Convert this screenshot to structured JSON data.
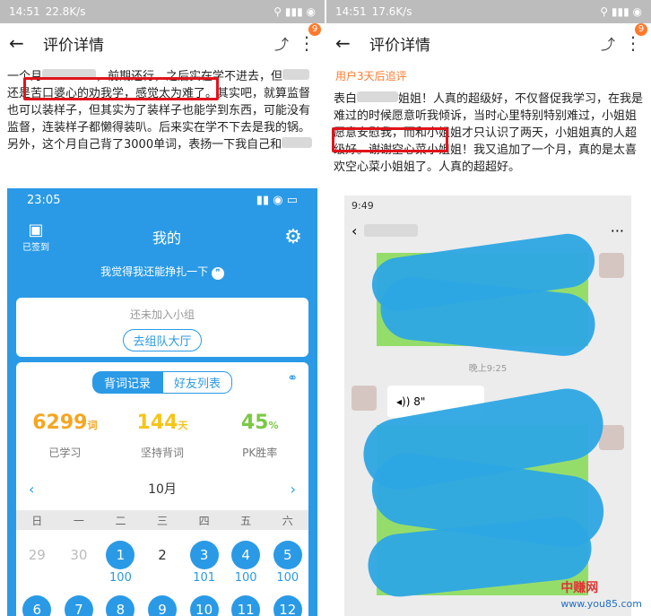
{
  "left": {
    "status": {
      "time": "14:51",
      "speed": "22.8K/s",
      "icons": "⚲ ▮▮▮ ◉"
    },
    "appbar": {
      "back": "←",
      "title": "评价详情",
      "share": "⤴",
      "more": "⋮",
      "badge": "9"
    },
    "review_text_1": "一个月",
    "review_text_2": "，前期还行，之后实在学不进去，但",
    "highlight": "还是苦口婆心的劝我学，",
    "review_text_3": "感觉太为难了。其实吧，就算监督也可以装样子，但其实为了装样子也能学到东西，可能没有监督，连装样子都懒得装叭。后来实在学不下去是我的锅。另外，这个月自己背了3000单词，表扬一下我自己和",
    "inner": {
      "time": "23:05",
      "signed": "已签到",
      "title": "我的",
      "motto": "我觉得我还能挣扎一下",
      "group_tip": "还未加入小组",
      "group_btn": "去组队大厅",
      "tab_words": "背词记录",
      "tab_friends": "好友列表",
      "stats": [
        {
          "num": "6299",
          "unit": "词",
          "label": "已学习",
          "color": "#f5a623"
        },
        {
          "num": "144",
          "unit": "天",
          "label": "坚持背词",
          "color": "#f5c51b"
        },
        {
          "num": "45",
          "unit": "%",
          "label": "PK胜率",
          "color": "#7ac943"
        }
      ],
      "month": "10月",
      "weekdays": [
        "日",
        "一",
        "二",
        "三",
        "四",
        "五",
        "六"
      ],
      "row1": [
        {
          "d": "29",
          "n": "",
          "style": "gray"
        },
        {
          "d": "30",
          "n": "",
          "style": "gray"
        },
        {
          "d": "1",
          "n": "100",
          "style": "blue"
        },
        {
          "d": "2",
          "n": "",
          "style": "plain"
        },
        {
          "d": "3",
          "n": "101",
          "style": "blue"
        },
        {
          "d": "4",
          "n": "100",
          "style": "blue"
        },
        {
          "d": "5",
          "n": "100",
          "style": "blue"
        }
      ],
      "row2": [
        "6",
        "7",
        "8",
        "9",
        "10",
        "11",
        "12"
      ]
    }
  },
  "right": {
    "status": {
      "time": "14:51",
      "speed": "17.6K/s",
      "icons": "⚲ ▮▮▮ ◉"
    },
    "appbar": {
      "back": "←",
      "title": "评价详情",
      "share": "⤴",
      "more": "⋮",
      "badge": "9"
    },
    "followup": "用户3天后追评",
    "text_1": "表白",
    "text_2": "姐姐！人真的超级好，不仅督促我学习，在我是难过的时候愿意听我倾诉，当时心里特别特别难过，",
    "highlight": "小姐姐愿意安慰我，",
    "text_3": "而和小姐姐才只认识了两天，小姐姐真的人超级好。谢谢空心菜小姐姐！我又追加了一个月，真的是太喜欢空心菜小姐姐了。人真的超超好。",
    "chat": {
      "time": "9:49",
      "timestamp": "晚上9:25",
      "voice": "◂)) 8\"",
      "back": "‹",
      "more": "···"
    }
  },
  "watermark": {
    "cn": "中赚网",
    "url": "www.you85.com"
  }
}
